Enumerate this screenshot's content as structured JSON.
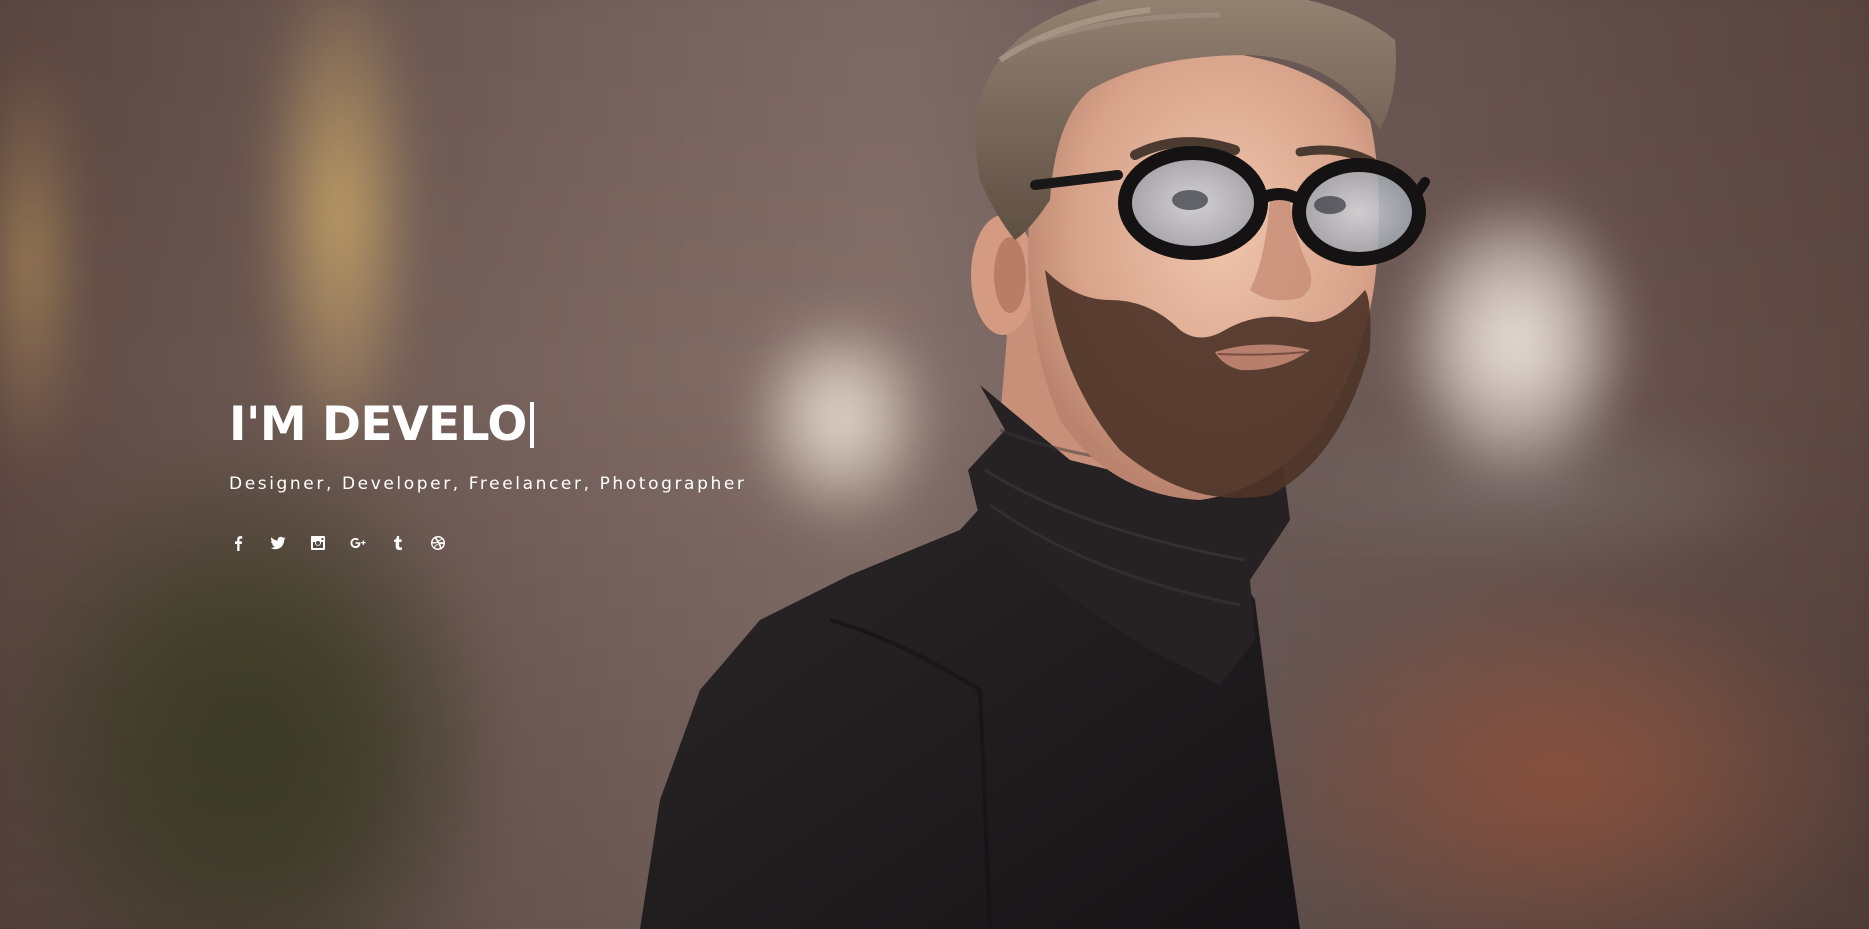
{
  "hero": {
    "headline": "I'M DEVELO",
    "roles": "Designer, Developer, Freelancer, Photographer"
  },
  "social": [
    {
      "name": "facebook",
      "icon": "facebook-icon"
    },
    {
      "name": "twitter",
      "icon": "twitter-icon"
    },
    {
      "name": "instagram",
      "icon": "instagram-icon"
    },
    {
      "name": "google-plus",
      "icon": "google-plus-icon"
    },
    {
      "name": "tumblr",
      "icon": "tumblr-icon"
    },
    {
      "name": "dribbble",
      "icon": "dribbble-icon"
    }
  ],
  "colors": {
    "text": "#ffffff",
    "sweater": "#221f21",
    "skin": "#d9a88d",
    "hair": "#7e6c5c"
  }
}
